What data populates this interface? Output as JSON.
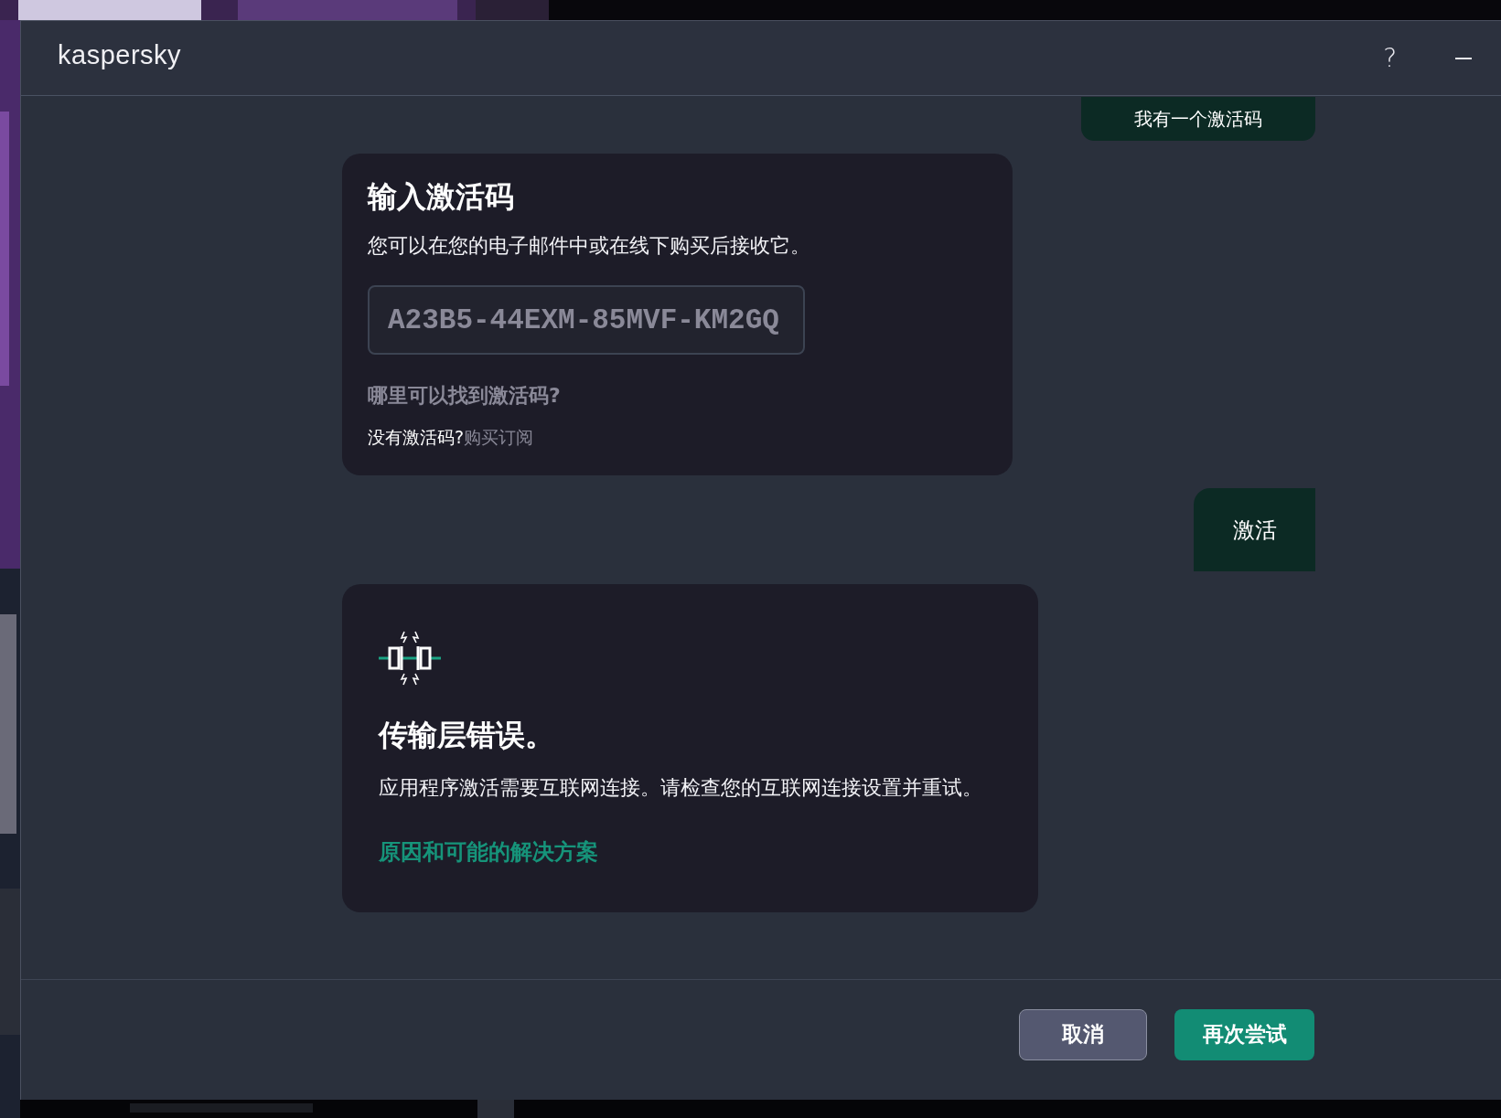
{
  "window": {
    "brand": "kaspersky",
    "help": "?"
  },
  "have_code_button": {
    "label": "我有一个激活码"
  },
  "code_card": {
    "title": "输入激活码",
    "description": "您可以在您的电子邮件中或在线下购买后接收它。",
    "code_field": {
      "placeholder": "A23B5-44EXM-85MVF-KM2GQ"
    },
    "help_link": "哪里可以找到激活码?",
    "no_code_text": "没有激活码?",
    "buy_link": "购买订阅"
  },
  "activate_button": {
    "label": "激活"
  },
  "error_card": {
    "title": "传输层错误。",
    "message": "应用程序激活需要互联网连接。请检查您的互联网连接设置并重试。",
    "solutions_link": "原因和可能的解决方案"
  },
  "footer_buttons": [
    {
      "label": "取消",
      "kind": "secondary"
    },
    {
      "label": "再次尝试",
      "kind": "primary"
    }
  ]
}
